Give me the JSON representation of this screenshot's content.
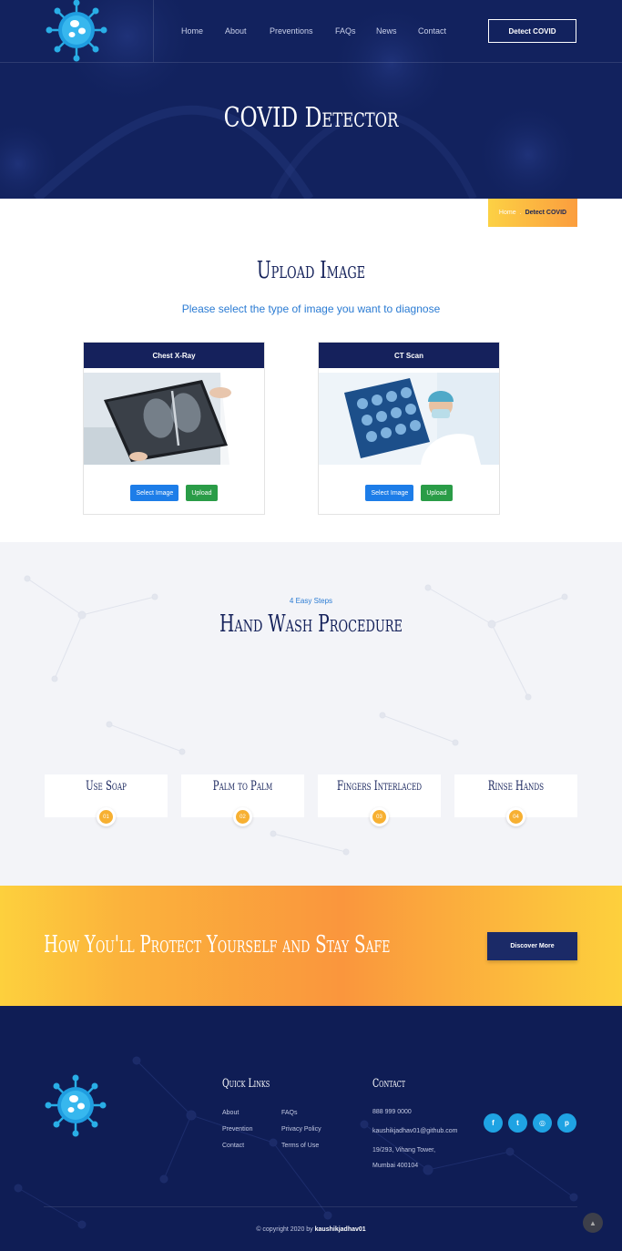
{
  "header": {
    "nav": [
      "Home",
      "About",
      "Preventions",
      "FAQs",
      "News",
      "Contact"
    ],
    "cta": "Detect COVID"
  },
  "hero": {
    "title": "COVID Detector"
  },
  "breadcrumb": {
    "home": "Home",
    "current": "Detect COVID"
  },
  "upload": {
    "title": "Upload Image",
    "subtitle": "Please select the type of image you want to diagnose",
    "cards": [
      {
        "title": "Chest X-Ray",
        "select": "Select Image",
        "upload": "Upload"
      },
      {
        "title": "CT Scan",
        "select": "Select Image",
        "upload": "Upload"
      }
    ]
  },
  "handwash": {
    "kicker": "4 Easy Steps",
    "title": "Hand Wash Procedure",
    "steps": [
      {
        "label": "Use Soap",
        "num": "01"
      },
      {
        "label": "Palm to Palm",
        "num": "02"
      },
      {
        "label": "Fingers Interlaced",
        "num": "03"
      },
      {
        "label": "Rinse Hands",
        "num": "04"
      }
    ]
  },
  "cta": {
    "title": "How You'll Protect Yourself and Stay Safe",
    "button": "Discover More"
  },
  "footer": {
    "quick_links_title": "Quick Links",
    "links_col1": [
      "About",
      "Prevention",
      "Contact"
    ],
    "links_col2": [
      "FAQs",
      "Privacy Policy",
      "Terms of Use"
    ],
    "contact_title": "Contact",
    "phone": "888 999 0000",
    "email": "kaushikjadhav01@github.com",
    "address1": "19/293, Vihang Tower,",
    "address2": "Mumbai 400104",
    "social": [
      "facebook-icon",
      "twitter-icon",
      "instagram-icon",
      "pinterest-icon"
    ],
    "copyright_prefix": "© copyright 2020 by",
    "copyright_name": "kaushikjadhav01"
  },
  "colors": {
    "navy": "#12225e",
    "accent": "#fb9d3e",
    "yellow": "#fcd144",
    "blue": "#1d7de8",
    "green": "#2a9c47"
  }
}
